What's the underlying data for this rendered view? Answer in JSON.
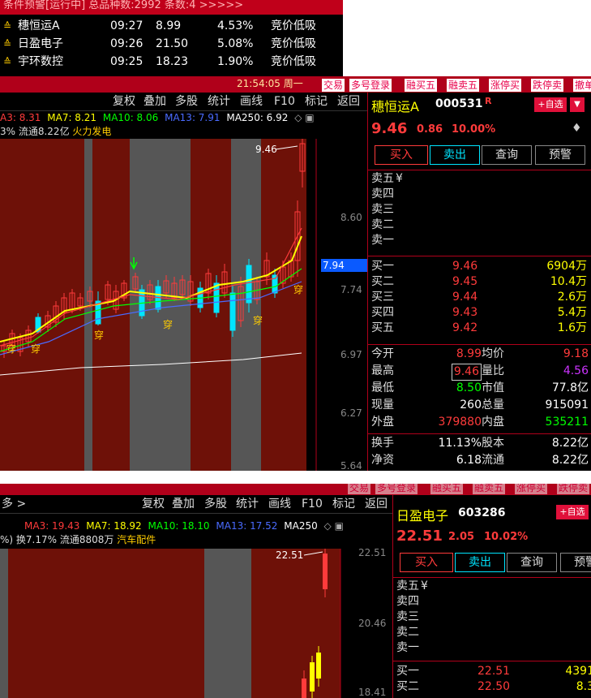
{
  "alert": {
    "title": "条件预警[运行中] 总品种数:2992 条数:4  >>>>>",
    "rows": [
      {
        "name": "穗恒运A",
        "time": "09:27",
        "price": "8.99",
        "pct": "4.53%",
        "cond": "竞价低吸"
      },
      {
        "name": "日盈电子",
        "time": "09:26",
        "price": "21.50",
        "pct": "5.08%",
        "cond": "竞价低吸"
      },
      {
        "name": "宇环数控",
        "time": "09:25",
        "price": "18.23",
        "pct": "1.90%",
        "cond": "竞价低吸"
      }
    ]
  },
  "top_menu": {
    "clock": "21:54:05 周一",
    "items": [
      "交易",
      "多号登录",
      "融买五",
      "融卖五",
      "涨停买",
      "跌停卖",
      "撤单"
    ]
  },
  "toolbar": {
    "items": [
      "复权",
      "叠加",
      "多股",
      "统计",
      "画线",
      "F10",
      "标记",
      "返回"
    ]
  },
  "panel1": {
    "ma_line": {
      "ma3": "A3: 8.31",
      "ma7": "MA7: 8.21",
      "ma10": "MA10: 8.06",
      "ma13": "MA13: 7.91",
      "ma250": "MA250: 6.92"
    },
    "info": "3% 流通8.22亿",
    "sector": "火力发电",
    "peak_label": "9.46",
    "y_labels": [
      "8.60",
      "7.74",
      "6.97",
      "6.27",
      "5.64"
    ],
    "cursor_price": "7.94",
    "chuan": [
      "穿",
      "穿",
      "穿",
      "穿",
      "穿",
      "穿"
    ],
    "stock": {
      "name": "穗恒运A",
      "code": "000531",
      "flag": "R",
      "price": "9.46",
      "change": "0.86",
      "pct": "10.00%"
    },
    "add_btn": "+自选",
    "buttons": [
      "买入",
      "卖出",
      "查询",
      "预警"
    ],
    "sells": [
      {
        "label": "卖五",
        "yen": "¥"
      },
      {
        "label": "卖四"
      },
      {
        "label": "卖三"
      },
      {
        "label": "卖二"
      },
      {
        "label": "卖一"
      }
    ],
    "buys": [
      {
        "label": "买一",
        "price": "9.46",
        "vol": "6904万"
      },
      {
        "label": "买二",
        "price": "9.45",
        "vol": "10.4万"
      },
      {
        "label": "买三",
        "price": "9.44",
        "vol": "2.6万"
      },
      {
        "label": "买四",
        "price": "9.43",
        "vol": "5.4万"
      },
      {
        "label": "买五",
        "price": "9.42",
        "vol": "1.6万"
      }
    ],
    "stats": [
      {
        "l1": "今开",
        "v1": "8.99",
        "l2": "均价",
        "v2": "9.18"
      },
      {
        "l1": "最高",
        "v1": "9.46",
        "l2": "量比",
        "v2": "4.56"
      },
      {
        "l1": "最低",
        "v1": "8.50",
        "l2": "市值",
        "v2": "77.8亿"
      },
      {
        "l1": "现量",
        "v1": "260",
        "l2": "总量",
        "v2": "915091"
      },
      {
        "l1": "外盘",
        "v1": "379880",
        "l2": "内盘",
        "v2": "535211"
      }
    ],
    "stats2": [
      {
        "l1": "换手",
        "v1": "11.13%",
        "l2": "股本",
        "v2": "8.22亿"
      },
      {
        "l1": "净资",
        "v1": "6.18",
        "l2": "流通",
        "v2": "8.22亿"
      }
    ]
  },
  "panel2": {
    "left_label": "多 >",
    "ma_line": {
      "ma3": "MA3: 19.43",
      "ma7": "MA7: 18.92",
      "ma10": "MA10: 18.10",
      "ma13": "MA13: 17.52",
      "ma250": "MA250"
    },
    "info": "%) 换7.17% 流通8808万",
    "sector": "汽车配件",
    "peak_label": "22.51",
    "y_labels": [
      "22.51",
      "20.46",
      "18.41"
    ],
    "stock": {
      "name": "日盈电子",
      "code": "603286",
      "price": "22.51",
      "change": "2.05",
      "pct": "10.02%"
    },
    "add_btn": "+自选",
    "buttons": [
      "买入",
      "卖出",
      "查询",
      "预警"
    ],
    "sells": [
      {
        "label": "卖五",
        "yen": "¥"
      },
      {
        "label": "卖四"
      },
      {
        "label": "卖三"
      },
      {
        "label": "卖二"
      },
      {
        "label": "卖一"
      }
    ],
    "buys": [
      {
        "label": "买一",
        "price": "22.51",
        "vol": "4391"
      },
      {
        "label": "买二",
        "price": "22.50",
        "vol": "8.3"
      }
    ]
  },
  "colors": {
    "up": "#ff3b3b",
    "down": "#00e5ff",
    "ma3": "#ffffff",
    "ma7": "#ffff00",
    "ma10": "#00ff00",
    "ma13": "#4a6bff",
    "ma250": "#ffffff",
    "bg_up": "#6e1108",
    "bg_gray": "#565656"
  }
}
